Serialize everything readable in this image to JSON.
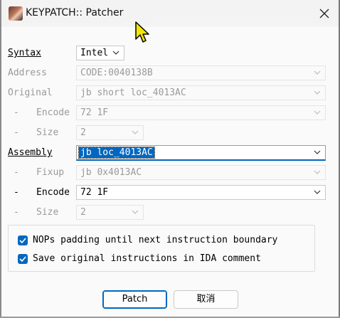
{
  "window": {
    "title": "KEYPATCH:: Patcher"
  },
  "fields": {
    "syntax": {
      "label": "Syntax",
      "value": "Intel"
    },
    "address": {
      "label": "Address",
      "value": "CODE:0040138B"
    },
    "original": {
      "label": "Original",
      "value": "jb short loc_4013AC"
    },
    "original_encode": {
      "dash": "-",
      "label": "Encode",
      "value": "72 1F"
    },
    "original_size": {
      "dash": "-",
      "label": "Size",
      "value": "2"
    },
    "assembly": {
      "label": "Assembly",
      "value": "jb loc_4013AC"
    },
    "fixup": {
      "dash": "-",
      "label": "Fixup",
      "value": "jb 0x4013AC"
    },
    "encode": {
      "dash": "-",
      "label": "Encode",
      "value": "72 1F"
    },
    "size": {
      "dash": "-",
      "label": "Size",
      "value": "2"
    }
  },
  "options": [
    {
      "label": "NOPs padding until next instruction boundary",
      "checked": true
    },
    {
      "label": "Save original instructions in IDA comment",
      "checked": true
    }
  ],
  "buttons": {
    "patch": "Patch",
    "cancel": "取消"
  },
  "colors": {
    "accent": "#0067c0",
    "disabled_text": "#9a9a9a"
  },
  "icons": {
    "app": "keypatch-avatar-icon",
    "close": "close-icon",
    "dropdown": "chevron-down-icon",
    "check": "checkmark-icon",
    "cursor": "mouse-cursor-icon"
  }
}
